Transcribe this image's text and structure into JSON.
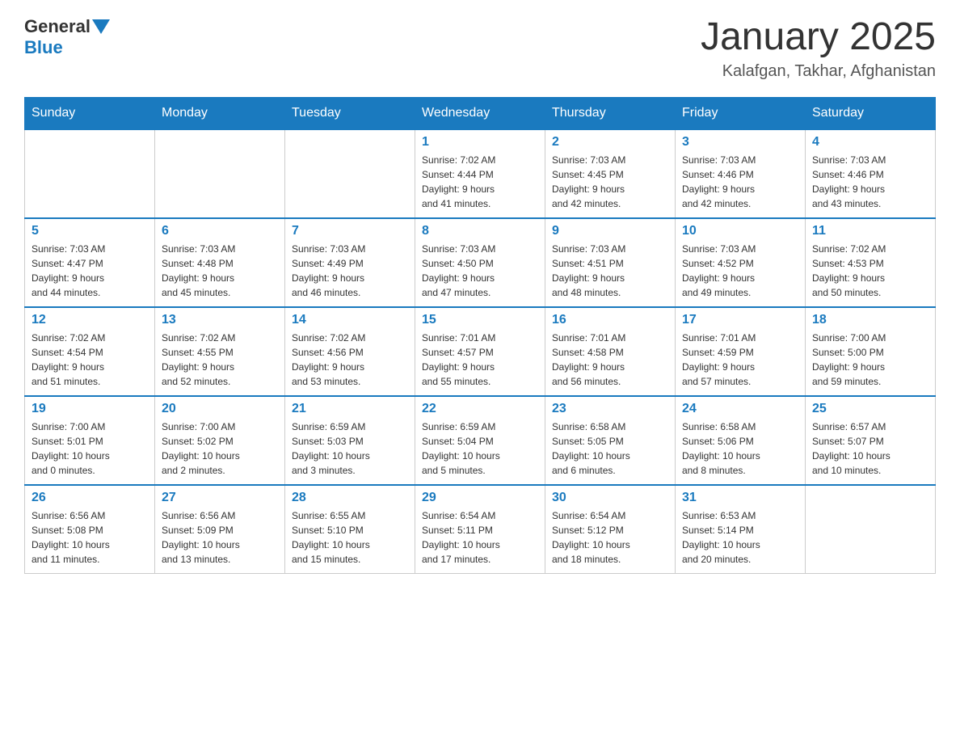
{
  "header": {
    "logo_text": "General",
    "logo_blue": "Blue",
    "title": "January 2025",
    "subtitle": "Kalafgan, Takhar, Afghanistan"
  },
  "days_of_week": [
    "Sunday",
    "Monday",
    "Tuesday",
    "Wednesday",
    "Thursday",
    "Friday",
    "Saturday"
  ],
  "weeks": [
    [
      {
        "day": "",
        "info": ""
      },
      {
        "day": "",
        "info": ""
      },
      {
        "day": "",
        "info": ""
      },
      {
        "day": "1",
        "info": "Sunrise: 7:02 AM\nSunset: 4:44 PM\nDaylight: 9 hours\nand 41 minutes."
      },
      {
        "day": "2",
        "info": "Sunrise: 7:03 AM\nSunset: 4:45 PM\nDaylight: 9 hours\nand 42 minutes."
      },
      {
        "day": "3",
        "info": "Sunrise: 7:03 AM\nSunset: 4:46 PM\nDaylight: 9 hours\nand 42 minutes."
      },
      {
        "day": "4",
        "info": "Sunrise: 7:03 AM\nSunset: 4:46 PM\nDaylight: 9 hours\nand 43 minutes."
      }
    ],
    [
      {
        "day": "5",
        "info": "Sunrise: 7:03 AM\nSunset: 4:47 PM\nDaylight: 9 hours\nand 44 minutes."
      },
      {
        "day": "6",
        "info": "Sunrise: 7:03 AM\nSunset: 4:48 PM\nDaylight: 9 hours\nand 45 minutes."
      },
      {
        "day": "7",
        "info": "Sunrise: 7:03 AM\nSunset: 4:49 PM\nDaylight: 9 hours\nand 46 minutes."
      },
      {
        "day": "8",
        "info": "Sunrise: 7:03 AM\nSunset: 4:50 PM\nDaylight: 9 hours\nand 47 minutes."
      },
      {
        "day": "9",
        "info": "Sunrise: 7:03 AM\nSunset: 4:51 PM\nDaylight: 9 hours\nand 48 minutes."
      },
      {
        "day": "10",
        "info": "Sunrise: 7:03 AM\nSunset: 4:52 PM\nDaylight: 9 hours\nand 49 minutes."
      },
      {
        "day": "11",
        "info": "Sunrise: 7:02 AM\nSunset: 4:53 PM\nDaylight: 9 hours\nand 50 minutes."
      }
    ],
    [
      {
        "day": "12",
        "info": "Sunrise: 7:02 AM\nSunset: 4:54 PM\nDaylight: 9 hours\nand 51 minutes."
      },
      {
        "day": "13",
        "info": "Sunrise: 7:02 AM\nSunset: 4:55 PM\nDaylight: 9 hours\nand 52 minutes."
      },
      {
        "day": "14",
        "info": "Sunrise: 7:02 AM\nSunset: 4:56 PM\nDaylight: 9 hours\nand 53 minutes."
      },
      {
        "day": "15",
        "info": "Sunrise: 7:01 AM\nSunset: 4:57 PM\nDaylight: 9 hours\nand 55 minutes."
      },
      {
        "day": "16",
        "info": "Sunrise: 7:01 AM\nSunset: 4:58 PM\nDaylight: 9 hours\nand 56 minutes."
      },
      {
        "day": "17",
        "info": "Sunrise: 7:01 AM\nSunset: 4:59 PM\nDaylight: 9 hours\nand 57 minutes."
      },
      {
        "day": "18",
        "info": "Sunrise: 7:00 AM\nSunset: 5:00 PM\nDaylight: 9 hours\nand 59 minutes."
      }
    ],
    [
      {
        "day": "19",
        "info": "Sunrise: 7:00 AM\nSunset: 5:01 PM\nDaylight: 10 hours\nand 0 minutes."
      },
      {
        "day": "20",
        "info": "Sunrise: 7:00 AM\nSunset: 5:02 PM\nDaylight: 10 hours\nand 2 minutes."
      },
      {
        "day": "21",
        "info": "Sunrise: 6:59 AM\nSunset: 5:03 PM\nDaylight: 10 hours\nand 3 minutes."
      },
      {
        "day": "22",
        "info": "Sunrise: 6:59 AM\nSunset: 5:04 PM\nDaylight: 10 hours\nand 5 minutes."
      },
      {
        "day": "23",
        "info": "Sunrise: 6:58 AM\nSunset: 5:05 PM\nDaylight: 10 hours\nand 6 minutes."
      },
      {
        "day": "24",
        "info": "Sunrise: 6:58 AM\nSunset: 5:06 PM\nDaylight: 10 hours\nand 8 minutes."
      },
      {
        "day": "25",
        "info": "Sunrise: 6:57 AM\nSunset: 5:07 PM\nDaylight: 10 hours\nand 10 minutes."
      }
    ],
    [
      {
        "day": "26",
        "info": "Sunrise: 6:56 AM\nSunset: 5:08 PM\nDaylight: 10 hours\nand 11 minutes."
      },
      {
        "day": "27",
        "info": "Sunrise: 6:56 AM\nSunset: 5:09 PM\nDaylight: 10 hours\nand 13 minutes."
      },
      {
        "day": "28",
        "info": "Sunrise: 6:55 AM\nSunset: 5:10 PM\nDaylight: 10 hours\nand 15 minutes."
      },
      {
        "day": "29",
        "info": "Sunrise: 6:54 AM\nSunset: 5:11 PM\nDaylight: 10 hours\nand 17 minutes."
      },
      {
        "day": "30",
        "info": "Sunrise: 6:54 AM\nSunset: 5:12 PM\nDaylight: 10 hours\nand 18 minutes."
      },
      {
        "day": "31",
        "info": "Sunrise: 6:53 AM\nSunset: 5:14 PM\nDaylight: 10 hours\nand 20 minutes."
      },
      {
        "day": "",
        "info": ""
      }
    ]
  ]
}
